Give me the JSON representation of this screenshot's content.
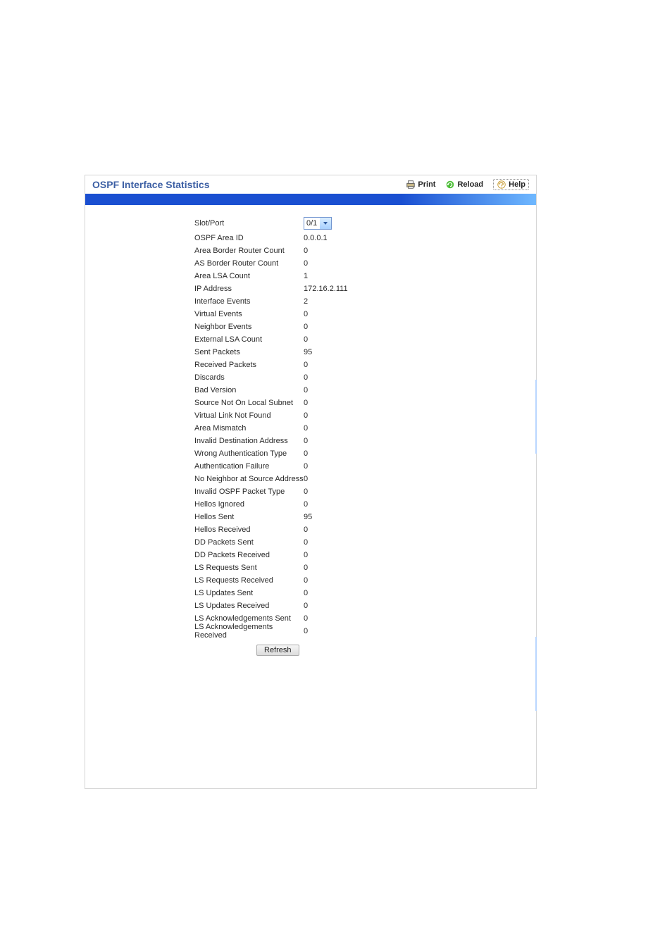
{
  "header": {
    "title": "OSPF Interface Statistics",
    "print": "Print",
    "reload": "Reload",
    "help": "Help"
  },
  "select": {
    "value": "0/1"
  },
  "rows": [
    {
      "label": "Slot/Port",
      "value": "__select__"
    },
    {
      "label": "OSPF Area ID",
      "value": "0.0.0.1"
    },
    {
      "label": "Area Border Router Count",
      "value": "0"
    },
    {
      "label": "AS Border Router Count",
      "value": "0"
    },
    {
      "label": "Area LSA Count",
      "value": "1"
    },
    {
      "label": "IP Address",
      "value": "172.16.2.111"
    },
    {
      "label": "Interface Events",
      "value": "2"
    },
    {
      "label": "Virtual Events",
      "value": "0"
    },
    {
      "label": "Neighbor Events",
      "value": "0"
    },
    {
      "label": "External LSA Count",
      "value": "0"
    },
    {
      "label": "Sent Packets",
      "value": "95"
    },
    {
      "label": "Received Packets",
      "value": "0"
    },
    {
      "label": "Discards",
      "value": "0"
    },
    {
      "label": "Bad Version",
      "value": "0"
    },
    {
      "label": "Source Not On Local Subnet",
      "value": "0"
    },
    {
      "label": "Virtual Link Not Found",
      "value": "0"
    },
    {
      "label": "Area Mismatch",
      "value": "0"
    },
    {
      "label": "Invalid Destination Address",
      "value": "0"
    },
    {
      "label": "Wrong Authentication Type",
      "value": "0"
    },
    {
      "label": "Authentication Failure",
      "value": "0"
    },
    {
      "label": "No Neighbor at Source Address",
      "value": "0"
    },
    {
      "label": "Invalid OSPF Packet Type",
      "value": "0"
    },
    {
      "label": "Hellos Ignored",
      "value": "0"
    },
    {
      "label": "Hellos Sent",
      "value": "95"
    },
    {
      "label": "Hellos Received",
      "value": "0"
    },
    {
      "label": "DD Packets Sent",
      "value": "0"
    },
    {
      "label": "DD Packets Received",
      "value": "0"
    },
    {
      "label": "LS Requests Sent",
      "value": "0"
    },
    {
      "label": "LS Requests Received",
      "value": "0"
    },
    {
      "label": "LS Updates Sent",
      "value": "0"
    },
    {
      "label": "LS Updates Received",
      "value": "0"
    },
    {
      "label": "LS Acknowledgements Sent",
      "value": "0"
    },
    {
      "label": "LS Acknowledgements Received",
      "value": "0"
    }
  ],
  "buttons": {
    "refresh": "Refresh"
  }
}
